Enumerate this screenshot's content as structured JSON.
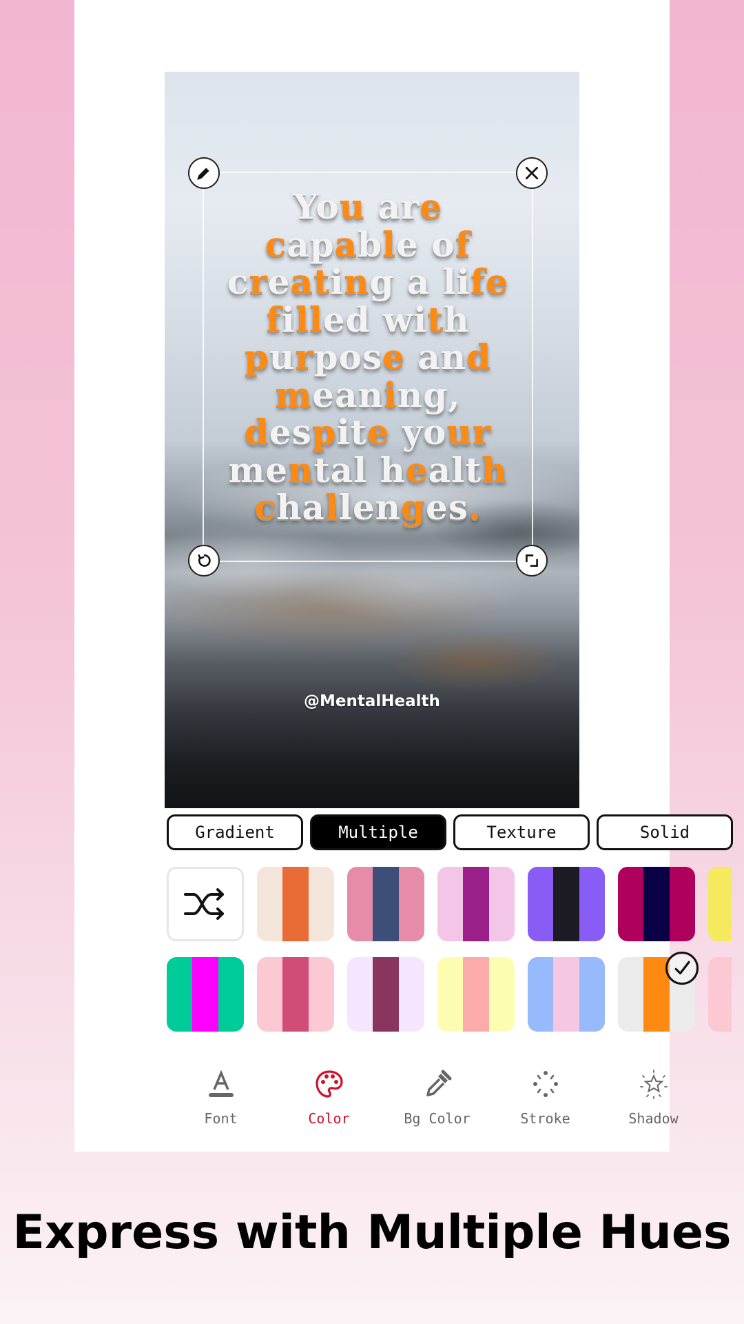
{
  "editor": {
    "quote": {
      "lines": [
        [
          [
            "You",
            "w"
          ],
          [
            " ",
            "w"
          ],
          [
            "are",
            "mix1"
          ]
        ],
        [
          [
            "capable of",
            "mix2"
          ]
        ],
        [
          [
            "creating a life",
            "mix3"
          ]
        ],
        [
          [
            "filled with",
            "mix4"
          ]
        ],
        [
          [
            "purpose and",
            "mix5"
          ]
        ],
        [
          [
            "meaning,",
            "mix6"
          ]
        ],
        [
          [
            "despite your",
            "mix7"
          ]
        ],
        [
          [
            "mental health",
            "mix8"
          ]
        ],
        [
          [
            "challenges.",
            "mix9"
          ]
        ]
      ],
      "full_text": "You are capable of creating a life filled with purpose and meaning, despite your mental health challenges.",
      "text_color_primary": "#f2f2f2",
      "text_color_accent": "#ff8a12"
    },
    "watermark": "@MentalHealth",
    "handles": {
      "edit_icon": "pencil-icon",
      "close_icon": "close-icon",
      "rotate_icon": "rotate-icon",
      "resize_icon": "resize-icon"
    }
  },
  "color_tabs": [
    {
      "label": "Gradient",
      "active": false
    },
    {
      "label": "Multiple",
      "active": true
    },
    {
      "label": "Texture",
      "active": false
    },
    {
      "label": "Solid",
      "active": false
    }
  ],
  "swatches": {
    "shuffle_icon": "shuffle-icon",
    "row1": [
      [
        "#f5e6dc",
        "#e96b35",
        "#f5e6dc"
      ],
      [
        "#e68ba8",
        "#3d4f78",
        "#e68ba8"
      ],
      [
        "#f3c6e7",
        "#9b1f88",
        "#f3c6e7"
      ],
      [
        "#8a5cf6",
        "#1c1a22",
        "#8a5cf6"
      ],
      [
        "#b0005e",
        "#0a0045",
        "#b0005e"
      ],
      [
        "#f5e95e",
        "#f5e95e",
        "#f5e95e"
      ]
    ],
    "row2": [
      [
        "#00cc99",
        "#ff00ff",
        "#00cc99"
      ],
      [
        "#fcc8d3",
        "#d04d78",
        "#fcc8d3"
      ],
      [
        "#f4e6fc",
        "#8a3560",
        "#f4e6fc"
      ],
      [
        "#fcfdb0",
        "#fcaaaa",
        "#fcfdb0"
      ],
      [
        "#96bafc",
        "#f6c7e2",
        "#96bafc"
      ],
      [
        "#ebebeb",
        "#ff8a12",
        "#ebebeb"
      ],
      [
        "#fcc8d3",
        "#fcc8d3",
        "#fcc8d3"
      ]
    ],
    "selected": {
      "row": 2,
      "index": 5
    }
  },
  "bottom_nav": [
    {
      "label": "Font",
      "icon": "font-icon",
      "active": false
    },
    {
      "label": "Color",
      "icon": "palette-icon",
      "active": true
    },
    {
      "label": "Bg Color",
      "icon": "eyedropper-icon",
      "active": false
    },
    {
      "label": "Stroke",
      "icon": "stroke-icon",
      "active": false
    },
    {
      "label": "Shadow",
      "icon": "shadow-star-icon",
      "active": false
    },
    {
      "label": "",
      "icon": "partial-icon",
      "active": false
    }
  ],
  "colors": {
    "active_accent": "#d0102c",
    "nav_inactive": "#666666"
  },
  "headline": "Express with Multiple Hues"
}
